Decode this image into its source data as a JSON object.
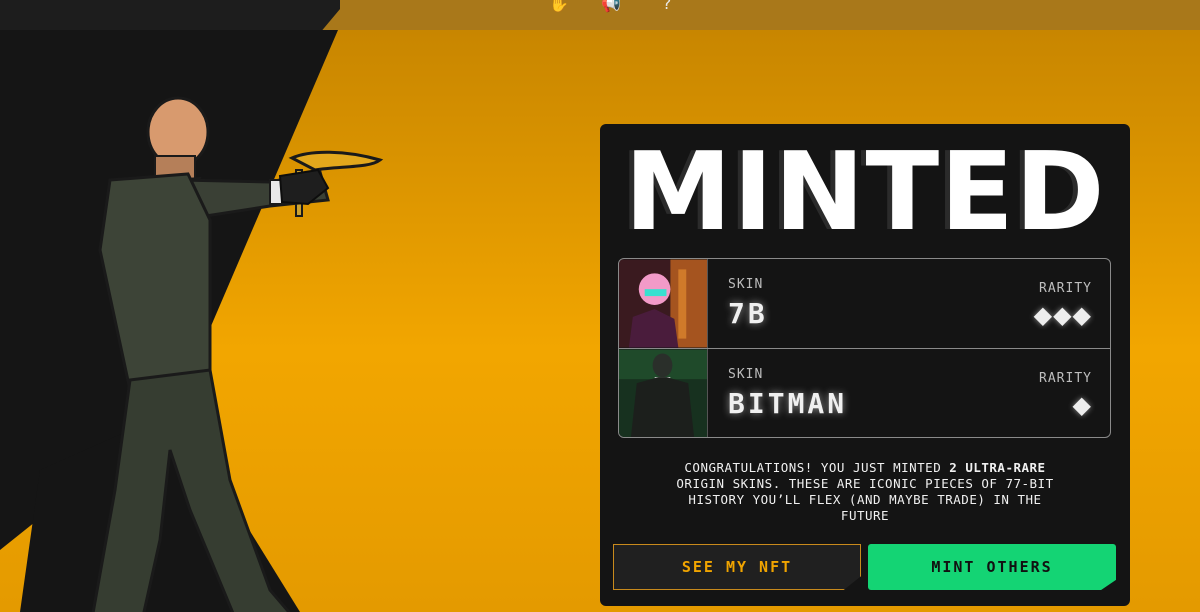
{
  "topbar": {
    "icons": [
      "hand-icon",
      "megaphone-icon",
      "help-icon"
    ]
  },
  "modal": {
    "title": "MINTED",
    "skins": [
      {
        "label": "SKIN",
        "name": "7B",
        "rarity_label": "RARITY",
        "rarity": "◆◆◆"
      },
      {
        "label": "SKIN",
        "name": "BITMAN",
        "rarity_label": "RARITY",
        "rarity": "◆"
      }
    ],
    "message_pre": "CONGRATULATIONS! YOU JUST MINTED ",
    "message_bold": "2 ULTRA-RARE",
    "message_post": " ORIGIN SKINS. THESE ARE ICONIC PIECES OF 77-BIT HISTORY YOU’LL FLEX (AND MAYBE TRADE) IN THE FUTURE",
    "see_button": "SEE MY NFT",
    "mint_button": "MINT OTHERS"
  },
  "colors": {
    "accent": "#f0a400",
    "mint": "#14d474",
    "card": "#141414"
  }
}
